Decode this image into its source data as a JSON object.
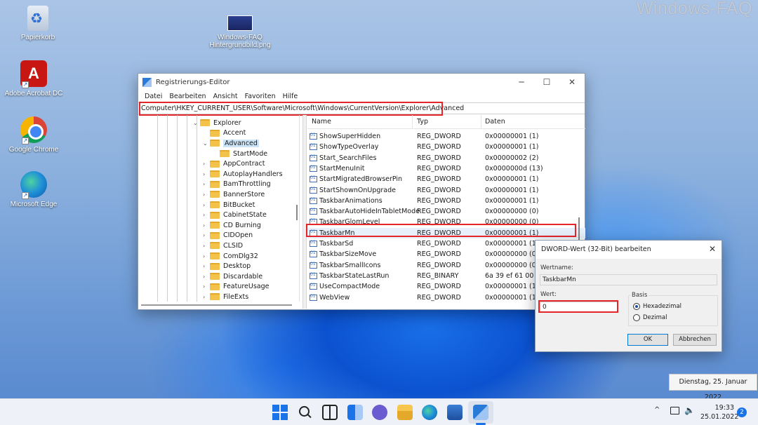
{
  "watermark": "Windows-FAQ",
  "desktop": {
    "icons": [
      {
        "label": "Papierkorb",
        "icon": "recycle-bin-icon"
      },
      {
        "label": "Adobe Acrobat DC",
        "icon": "acrobat-icon"
      },
      {
        "label": "Google Chrome",
        "icon": "chrome-icon"
      },
      {
        "label": "Microsoft Edge",
        "icon": "edge-icon"
      },
      {
        "label_line1": "Windows-FAQ",
        "label_line2": "Hintergrundbild.png",
        "icon": "image-file-icon"
      }
    ]
  },
  "regedit": {
    "title": "Registrierungs-Editor",
    "menu": [
      "Datei",
      "Bearbeiten",
      "Ansicht",
      "Favoriten",
      "Hilfe"
    ],
    "address": "Computer\\HKEY_CURRENT_USER\\Software\\Microsoft\\Windows\\CurrentVersion\\Explorer\\Advanced",
    "tree": [
      {
        "label": "Explorer",
        "expanded": true
      },
      {
        "label": "Accent"
      },
      {
        "label": "Advanced",
        "expanded": true,
        "selected": true
      },
      {
        "label": "StartMode"
      },
      {
        "label": "AppContract"
      },
      {
        "label": "AutoplayHandlers"
      },
      {
        "label": "BamThrottling"
      },
      {
        "label": "BannerStore"
      },
      {
        "label": "BitBucket"
      },
      {
        "label": "CabinetState"
      },
      {
        "label": "CD Burning"
      },
      {
        "label": "CIDOpen"
      },
      {
        "label": "CLSID"
      },
      {
        "label": "ComDlg32"
      },
      {
        "label": "Desktop"
      },
      {
        "label": "Discardable"
      },
      {
        "label": "FeatureUsage"
      },
      {
        "label": "FileExts"
      }
    ],
    "columns": {
      "name": "Name",
      "type": "Typ",
      "data": "Daten"
    },
    "values": [
      {
        "name": "ShowSuperHidden",
        "type": "REG_DWORD",
        "data": "0x00000001 (1)"
      },
      {
        "name": "ShowTypeOverlay",
        "type": "REG_DWORD",
        "data": "0x00000001 (1)"
      },
      {
        "name": "Start_SearchFiles",
        "type": "REG_DWORD",
        "data": "0x00000002 (2)"
      },
      {
        "name": "StartMenuInit",
        "type": "REG_DWORD",
        "data": "0x0000000d (13)"
      },
      {
        "name": "StartMigratedBrowserPin",
        "type": "REG_DWORD",
        "data": "0x00000001 (1)"
      },
      {
        "name": "StartShownOnUpgrade",
        "type": "REG_DWORD",
        "data": "0x00000001 (1)"
      },
      {
        "name": "TaskbarAnimations",
        "type": "REG_DWORD",
        "data": "0x00000001 (1)"
      },
      {
        "name": "TaskbarAutoHideInTabletMode",
        "type": "REG_DWORD",
        "data": "0x00000000 (0)"
      },
      {
        "name": "TaskbarGlomLevel",
        "type": "REG_DWORD",
        "data": "0x00000000 (0)"
      },
      {
        "name": "TaskbarMn",
        "type": "REG_DWORD",
        "data": "0x00000001 (1)",
        "highlighted": true
      },
      {
        "name": "TaskbarSd",
        "type": "REG_DWORD",
        "data": "0x00000001 (1)"
      },
      {
        "name": "TaskbarSizeMove",
        "type": "REG_DWORD",
        "data": "0x00000000 (0)"
      },
      {
        "name": "TaskbarSmallIcons",
        "type": "REG_DWORD",
        "data": "0x00000000 (0)"
      },
      {
        "name": "TaskbarStateLastRun",
        "type": "REG_BINARY",
        "data": "6a 39 ef 61 00 00"
      },
      {
        "name": "UseCompactMode",
        "type": "REG_DWORD",
        "data": "0x00000001 (1)"
      },
      {
        "name": "WebView",
        "type": "REG_DWORD",
        "data": "0x00000001 (1)"
      }
    ]
  },
  "dialog": {
    "title": "DWORD-Wert (32-Bit) bearbeiten",
    "name_label": "Wertname:",
    "name_value": "TaskbarMn",
    "value_label": "Wert:",
    "value_value": "0",
    "base_label": "Basis",
    "hex_label": "Hexadezimal",
    "dec_label": "Dezimal",
    "base_selected": "Hexadezimal",
    "ok": "OK",
    "cancel": "Abbrechen"
  },
  "date_tooltip": "Dienstag, 25. Januar 2022",
  "taskbar": {
    "time": "19:33",
    "date": "25.01.2022",
    "notifications": "2",
    "chevron": "^"
  }
}
